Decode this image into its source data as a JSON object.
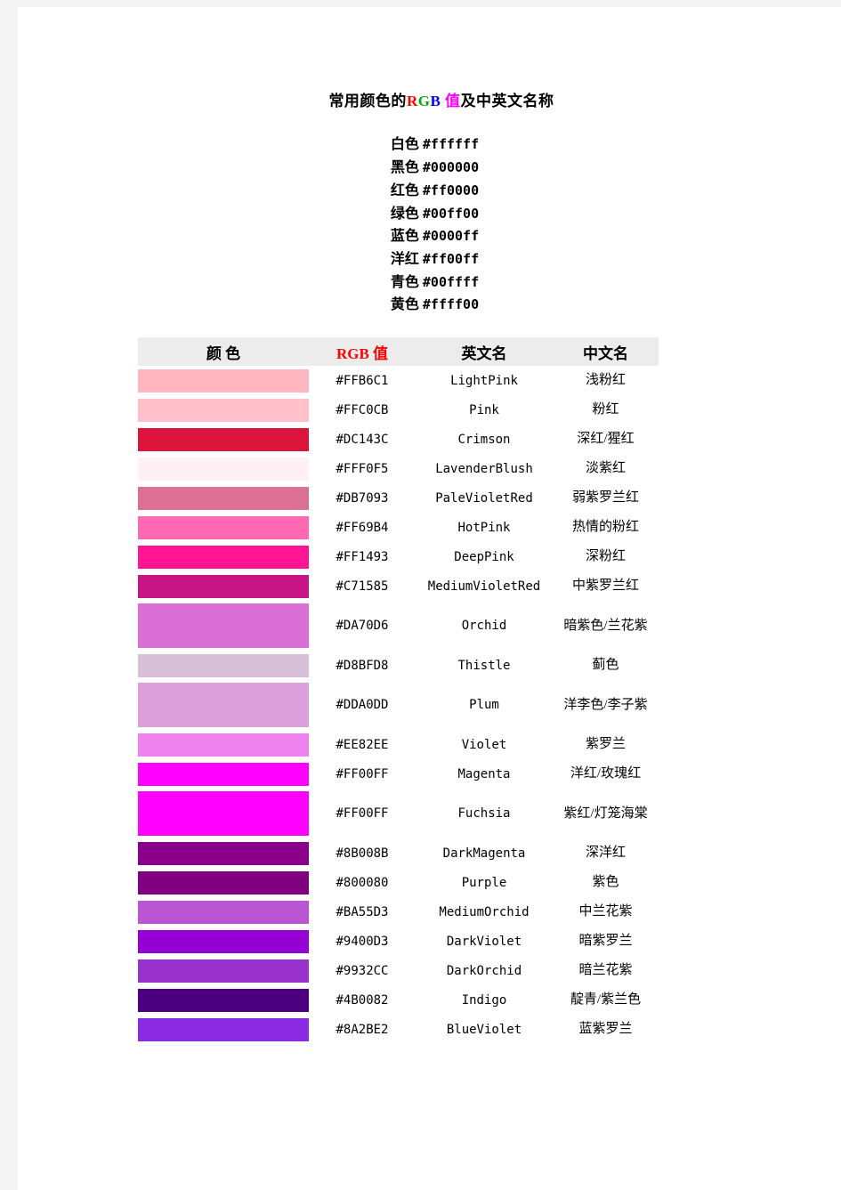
{
  "document": {
    "title_parts": [
      {
        "text": "常用颜色的",
        "color": "#000000"
      },
      {
        "text": "R",
        "color": "#ff0000"
      },
      {
        "text": "G",
        "color": "#00b000"
      },
      {
        "text": "B",
        "color": "#0000ff"
      },
      {
        "text": " ",
        "color": "#000000"
      },
      {
        "text": "值",
        "color": "#ff00ff"
      },
      {
        "text": "及中英文名称",
        "color": "#000000"
      }
    ],
    "title_plain": "常用颜色的RGB 值及中英文名称"
  },
  "basic_colors": [
    {
      "name": "白色",
      "hex": "#ffffff"
    },
    {
      "name": "黑色",
      "hex": "#000000"
    },
    {
      "name": "红色",
      "hex": "#ff0000"
    },
    {
      "name": "绿色",
      "hex": "#00ff00"
    },
    {
      "name": "蓝色",
      "hex": "#0000ff"
    },
    {
      "name": "洋红",
      "hex": "#ff00ff"
    },
    {
      "name": "青色",
      "hex": "#00ffff"
    },
    {
      "name": "黄色",
      "hex": "#ffff00"
    }
  ],
  "table": {
    "headers": {
      "swatch": "颜        色",
      "rgb": "RGB 值",
      "english": "英文名",
      "chinese": "中文名"
    },
    "header_rgb_color": "#ff0000",
    "header_background": "#ececec",
    "rows": [
      {
        "hex": "#FFB6C1",
        "english": "LightPink",
        "chinese": "浅粉红",
        "tall": false
      },
      {
        "hex": "#FFC0CB",
        "english": "Pink",
        "chinese": "粉红",
        "tall": false
      },
      {
        "hex": "#DC143C",
        "english": "Crimson",
        "chinese": "深红/猩红",
        "tall": false
      },
      {
        "hex": "#FFF0F5",
        "english": "LavenderBlush",
        "chinese": "淡紫红",
        "tall": false
      },
      {
        "hex": "#DB7093",
        "english": "PaleVioletRed",
        "chinese": "弱紫罗兰红",
        "tall": false
      },
      {
        "hex": "#FF69B4",
        "english": "HotPink",
        "chinese": "热情的粉红",
        "tall": false
      },
      {
        "hex": "#FF1493",
        "english": "DeepPink",
        "chinese": "深粉红",
        "tall": false
      },
      {
        "hex": "#C71585",
        "english": "MediumVioletRed",
        "chinese": "中紫罗兰红",
        "tall": false
      },
      {
        "hex": "#DA70D6",
        "english": "Orchid",
        "chinese": "暗紫色/兰花紫",
        "tall": true
      },
      {
        "hex": "#D8BFD8",
        "english": "Thistle",
        "chinese": "蓟色",
        "tall": false
      },
      {
        "hex": "#DDA0DD",
        "english": "Plum",
        "chinese": "洋李色/李子紫",
        "tall": true
      },
      {
        "hex": "#EE82EE",
        "english": "Violet",
        "chinese": "紫罗兰",
        "tall": false
      },
      {
        "hex": "#FF00FF",
        "english": "Magenta",
        "chinese": "洋红/玫瑰红",
        "tall": false
      },
      {
        "hex": "#FF00FF",
        "english": "Fuchsia",
        "chinese": "紫红/灯笼海棠",
        "tall": true
      },
      {
        "hex": "#8B008B",
        "english": "DarkMagenta",
        "chinese": "深洋红",
        "tall": false
      },
      {
        "hex": "#800080",
        "english": "Purple",
        "chinese": "紫色",
        "tall": false
      },
      {
        "hex": "#BA55D3",
        "english": "MediumOrchid",
        "chinese": "中兰花紫",
        "tall": false
      },
      {
        "hex": "#9400D3",
        "english": "DarkViolet",
        "chinese": "暗紫罗兰",
        "tall": false
      },
      {
        "hex": "#9932CC",
        "english": "DarkOrchid",
        "chinese": "暗兰花紫",
        "tall": false
      },
      {
        "hex": "#4B0082",
        "english": "Indigo",
        "chinese": "靛青/紫兰色",
        "tall": false
      },
      {
        "hex": "#8A2BE2",
        "english": "BlueViolet",
        "chinese": "蓝紫罗兰",
        "tall": false
      }
    ]
  }
}
